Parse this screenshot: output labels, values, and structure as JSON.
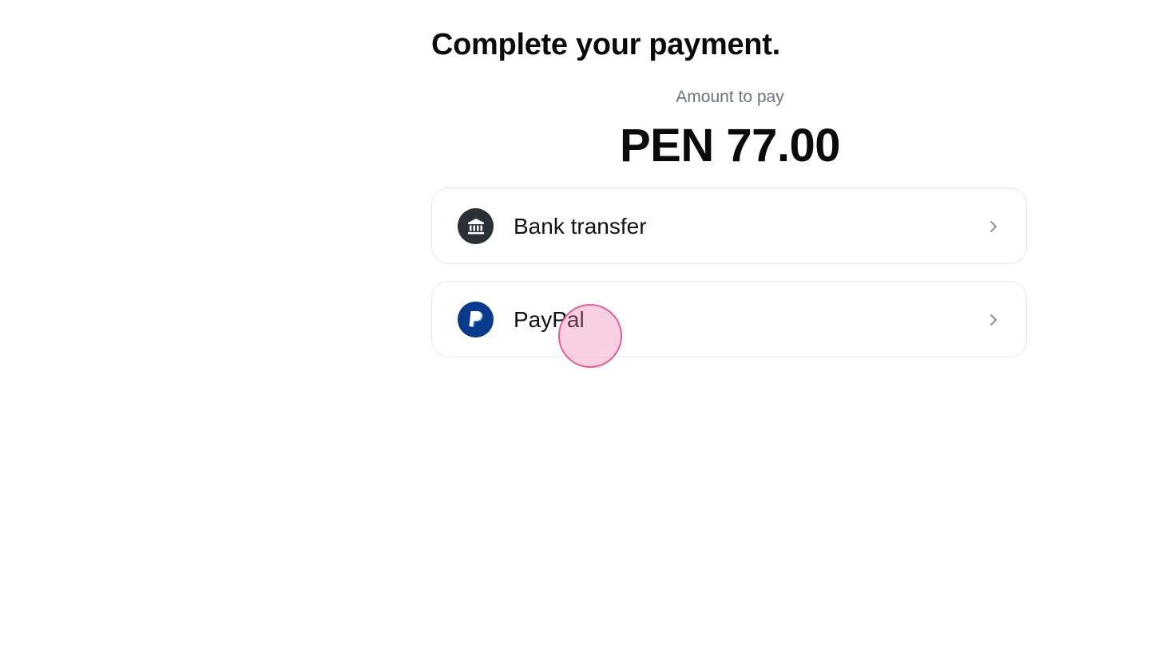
{
  "page": {
    "title": "Complete your payment."
  },
  "amount": {
    "label": "Amount to pay",
    "value": "PEN 77.00"
  },
  "payment_methods": [
    {
      "label": "Bank transfer",
      "icon": "bank-icon"
    },
    {
      "label": "PayPal",
      "icon": "paypal-icon"
    }
  ],
  "colors": {
    "bank_icon_bg": "#2b2f36",
    "paypal_icon_bg": "#0a3a8c",
    "card_border": "#e5e7eb",
    "label_gray": "#6b7280",
    "click_indicator": "#e0599a"
  }
}
